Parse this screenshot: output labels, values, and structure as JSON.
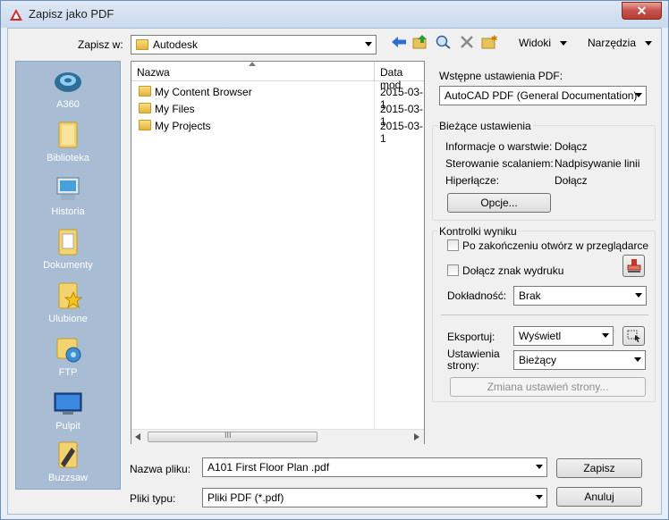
{
  "window": {
    "title": "Zapisz jako PDF",
    "close_label": "✕"
  },
  "toolbar": {
    "save_in_label": "Zapisz w:",
    "save_in_value": "Autodesk",
    "views_label": "Widoki",
    "tools_label": "Narzędzia"
  },
  "places": [
    {
      "label": "A360",
      "icon": "a360-icon"
    },
    {
      "label": "Biblioteka",
      "icon": "library-folder-icon"
    },
    {
      "label": "Historia",
      "icon": "history-icon"
    },
    {
      "label": "Dokumenty",
      "icon": "documents-icon"
    },
    {
      "label": "Ulubione",
      "icon": "favorites-icon"
    },
    {
      "label": "FTP",
      "icon": "ftp-icon"
    },
    {
      "label": "Pulpit",
      "icon": "desktop-icon"
    },
    {
      "label": "Buzzsaw",
      "icon": "buzzsaw-icon"
    }
  ],
  "filelist": {
    "col_name": "Nazwa",
    "col_date": "Data mod",
    "rows": [
      {
        "name": "My Content Browser",
        "date": "2015-03-1"
      },
      {
        "name": "My Files",
        "date": "2015-03-1"
      },
      {
        "name": "My Projects",
        "date": "2015-03-1"
      }
    ],
    "scroll_grip": "III"
  },
  "pdf": {
    "preset_label": "Wstępne ustawienia PDF:",
    "preset_value": "AutoCAD PDF (General Documentation)"
  },
  "current": {
    "title": "Bieżące ustawienia",
    "layers_label": "Informacje o warstwie:",
    "layers_value": "Dołącz",
    "scaling_label": "Sterowanie scalaniem:",
    "scaling_value": "Nadpisywanie linii",
    "links_label": "Hiperłącze:",
    "links_value": "Dołącz",
    "options_button": "Opcje..."
  },
  "output": {
    "title": "Kontrolki wyniku",
    "open_in_viewer": "Po zakończeniu otwórz w przeglądarce",
    "include_stamp": "Dołącz znak wydruku",
    "precision_label": "Dokładność:",
    "precision_value": "Brak",
    "export_label": "Eksportuj:",
    "export_value": "Wyświetl",
    "page_setup_label_1": "Ustawienia",
    "page_setup_label_2": "strony:",
    "page_setup_value": "Bieżący",
    "change_page_setup_button": "Zmiana ustawień strony..."
  },
  "footer": {
    "filename_label": "Nazwa pliku:",
    "filename_value": "A101 First Floor Plan .pdf",
    "filetype_label": "Pliki typu:",
    "filetype_value": "Pliki PDF (*.pdf)",
    "save_button": "Zapisz",
    "cancel_button": "Anuluj"
  },
  "colors": {
    "places_bg": "#a8bdd4",
    "title_bg": "#dfe9f5",
    "close_red": "#c75050"
  }
}
